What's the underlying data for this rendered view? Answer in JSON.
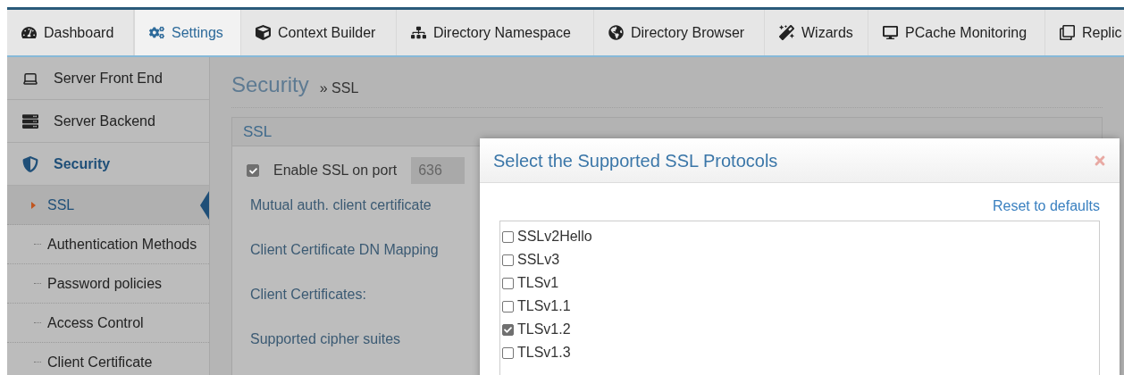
{
  "tabs": [
    {
      "label": "Dashboard",
      "selected": false
    },
    {
      "label": "Settings",
      "selected": true
    },
    {
      "label": "Context Builder",
      "selected": false
    },
    {
      "label": "Directory Namespace",
      "selected": false
    },
    {
      "label": "Directory Browser",
      "selected": false
    },
    {
      "label": "Wizards",
      "selected": false
    },
    {
      "label": "PCache Monitoring",
      "selected": false
    },
    {
      "label": "Replic",
      "selected": false
    }
  ],
  "sidebar": {
    "items": [
      {
        "label": "Server Front End",
        "selected": false
      },
      {
        "label": "Server Backend",
        "selected": false
      },
      {
        "label": "Security",
        "selected": true,
        "children": [
          {
            "label": "SSL",
            "selected": true
          },
          {
            "label": "Authentication Methods",
            "selected": false
          },
          {
            "label": "Password policies",
            "selected": false
          },
          {
            "label": "Access Control",
            "selected": false
          },
          {
            "label": "Client Certificate",
            "selected": false
          }
        ]
      }
    ]
  },
  "breadcrumb": {
    "section": "Security",
    "separator": "»",
    "page": "SSL"
  },
  "panel": {
    "title": "SSL",
    "enable_ssl": {
      "label": "Enable SSL on port",
      "checked": true,
      "port": "636"
    },
    "fields": [
      "Mutual auth. client certificate",
      "Client Certificate DN Mapping",
      "Client Certificates:",
      "Supported cipher suites"
    ]
  },
  "dialog": {
    "title": "Select the Supported SSL Protocols",
    "reset_link": "Reset to defaults",
    "protocols": [
      {
        "label": "SSLv2Hello",
        "checked": false
      },
      {
        "label": "SSLv3",
        "checked": false
      },
      {
        "label": "TLSv1",
        "checked": false
      },
      {
        "label": "TLSv1.1",
        "checked": false
      },
      {
        "label": "TLSv1.2",
        "checked": true
      },
      {
        "label": "TLSv1.3",
        "checked": false
      }
    ]
  }
}
